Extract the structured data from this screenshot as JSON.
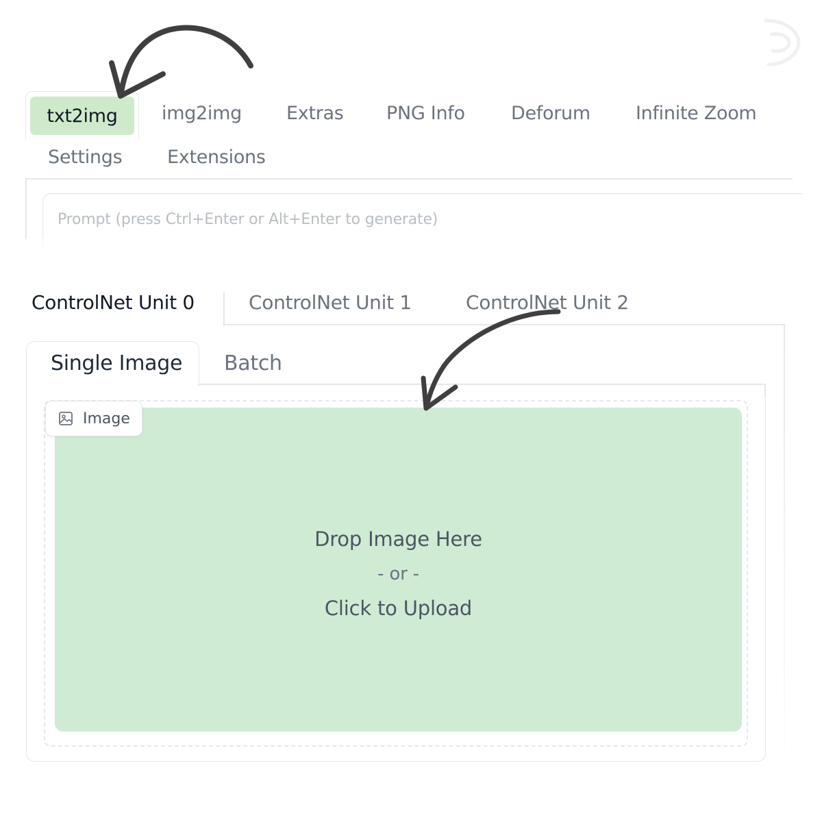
{
  "top_tabs": [
    {
      "label": "txt2img",
      "active": true
    },
    {
      "label": "img2img",
      "active": false
    },
    {
      "label": "Extras",
      "active": false
    },
    {
      "label": "PNG Info",
      "active": false
    },
    {
      "label": "Deforum",
      "active": false
    },
    {
      "label": "Infinite Zoom",
      "active": false
    },
    {
      "label": "Settings",
      "active": false
    },
    {
      "label": "Extensions",
      "active": false
    }
  ],
  "prompt": {
    "placeholder": "Prompt (press Ctrl+Enter or Alt+Enter to generate)",
    "value": ""
  },
  "controlnet_tabs": [
    {
      "label": "ControlNet Unit 0",
      "active": true
    },
    {
      "label": "ControlNet Unit 1",
      "active": false
    },
    {
      "label": "ControlNet Unit 2",
      "active": false
    }
  ],
  "sub_tabs": [
    {
      "label": "Single Image",
      "active": true
    },
    {
      "label": "Batch",
      "active": false
    }
  ],
  "image_block": {
    "label": "Image",
    "icon": "image-icon",
    "drop_text": "Drop Image Here",
    "or_text": "- or -",
    "upload_text": "Click to Upload"
  },
  "colors": {
    "active_tab_bg": "#cfeacb",
    "dropzone_bg": "#d0ebd4",
    "arrow": "#3f3f3f"
  }
}
